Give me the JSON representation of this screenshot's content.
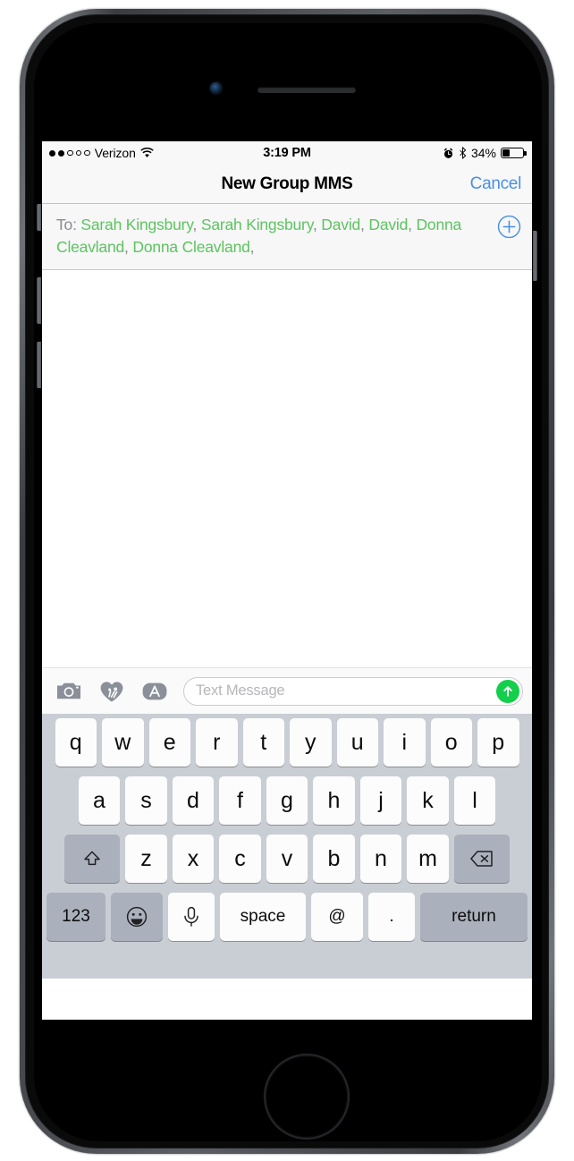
{
  "device": {
    "name": "iphone-space-gray",
    "front_camera": "camera-icon",
    "earpiece": "speaker-grille",
    "home_button": "home-button"
  },
  "status_bar": {
    "signal_dots_filled": 2,
    "signal_dots_total": 5,
    "carrier": "Verizon",
    "wifi": "wifi-icon",
    "time": "3:19 PM",
    "alarm": "alarm-clock-icon",
    "bluetooth": "bluetooth-icon",
    "battery_percent": "34%",
    "battery_level": 34
  },
  "nav_bar": {
    "title": "New Group MMS",
    "cancel_label": "Cancel",
    "cancel_color": "#4a90e2"
  },
  "to_field": {
    "label": "To:",
    "recipients": [
      "Sarah Kingsbury",
      "Sarah Kingsbury",
      "David",
      "David",
      "Donna Cleavland",
      "Donna Cleavland"
    ],
    "separator": ", ",
    "trailing_separator": ",",
    "recipient_color": "#5cc460",
    "add_contact_icon": "plus-circle-icon"
  },
  "message_toolbar": {
    "camera_icon": "camera-icon",
    "digital_touch_icon": "heart-digital-touch-icon",
    "app_store_icon": "app-store-icon",
    "input_placeholder": "Text Message",
    "input_value": "",
    "send_icon": "send-arrow-up-icon",
    "send_color": "#13cf4b"
  },
  "keyboard": {
    "row1": [
      "q",
      "w",
      "e",
      "r",
      "t",
      "y",
      "u",
      "i",
      "o",
      "p"
    ],
    "row2": [
      "a",
      "s",
      "d",
      "f",
      "g",
      "h",
      "j",
      "k",
      "l"
    ],
    "row3": [
      "z",
      "x",
      "c",
      "v",
      "b",
      "n",
      "m"
    ],
    "shift_icon": "shift-up-arrow-icon",
    "backspace_icon": "backspace-delete-icon",
    "numbers_label": "123",
    "emoji_icon": "emoji-smiley-icon",
    "mic_icon": "microphone-icon",
    "space_label": "space",
    "at_label": "@",
    "period_label": ".",
    "return_label": "return"
  }
}
